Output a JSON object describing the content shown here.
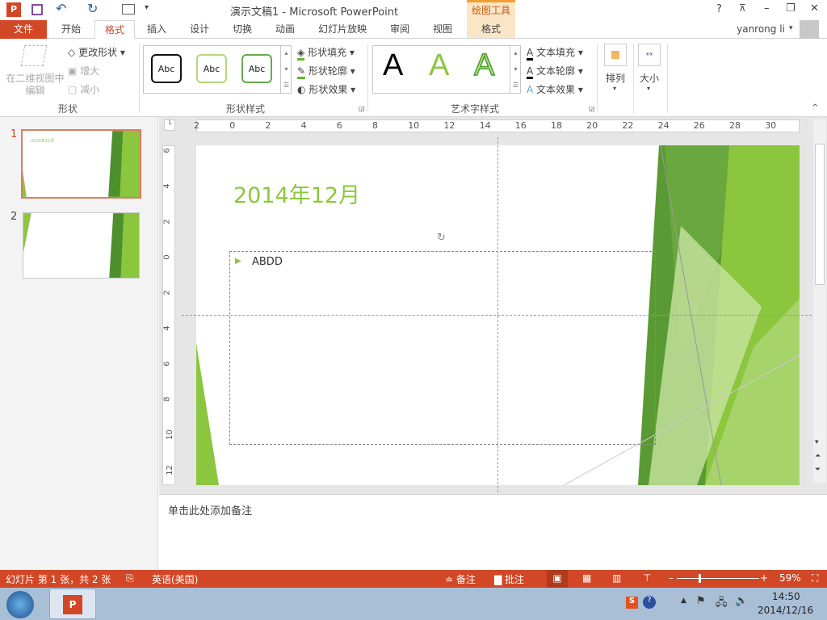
{
  "title_bar": {
    "title": "演示文稿1 - Microsoft PowerPoint",
    "context_tool": "绘图工具",
    "help": "?",
    "ribbon_display": "⊼",
    "minimize": "–",
    "restore": "❐",
    "close": "✕",
    "qat_more": "▾"
  },
  "tabs": {
    "file": "文件",
    "items": [
      "开始",
      "格式",
      "插入",
      "设计",
      "切换",
      "动画",
      "幻灯片放映",
      "审阅",
      "视图"
    ],
    "context_tab": "格式",
    "user": "yanrong li"
  },
  "ribbon": {
    "shape_group": {
      "edit_3d": "在二维视图中编辑",
      "change_shape": "更改形状",
      "increase": "增大",
      "decrease": "减小",
      "label": "形状"
    },
    "shape_styles": {
      "samples": [
        "Abc",
        "Abc",
        "Abc"
      ],
      "fill": "形状填充",
      "outline": "形状轮廓",
      "effects": "形状效果",
      "label": "形状样式"
    },
    "wordart": {
      "samples": [
        "A",
        "A",
        "A"
      ],
      "fill": "文本填充",
      "outline": "文本轮廓",
      "effects": "文本效果",
      "label": "艺术字样式"
    },
    "arrange": "排列",
    "size": "大小"
  },
  "ruler": {
    "h_ticks": [
      "2",
      "0",
      "2",
      "4",
      "6",
      "8",
      "10",
      "12",
      "14",
      "16",
      "18",
      "20",
      "22",
      "24",
      "26",
      "28",
      "30"
    ],
    "v_ticks": [
      "6",
      "4",
      "2",
      "0",
      "2",
      "4",
      "6",
      "8",
      "10",
      "12"
    ]
  },
  "thumbnails": [
    {
      "number": "1",
      "title": "2014年12月"
    },
    {
      "number": "2"
    }
  ],
  "slide": {
    "title": "2014年12月",
    "bullet": "ABDD"
  },
  "notes": {
    "placeholder": "单击此处添加备注"
  },
  "status": {
    "slide_info": "幻灯片 第 1 张，共 2 张",
    "language": "英语(美国)",
    "notes": "备注",
    "comments": "批注",
    "zoom": "59%",
    "zoom_fraction": 0.59
  },
  "taskbar": {
    "time": "14:50",
    "date": "2014/12/16"
  },
  "colors": {
    "accent": "#d24726",
    "green": "#8cc63f",
    "context": "#fbe5c8"
  }
}
